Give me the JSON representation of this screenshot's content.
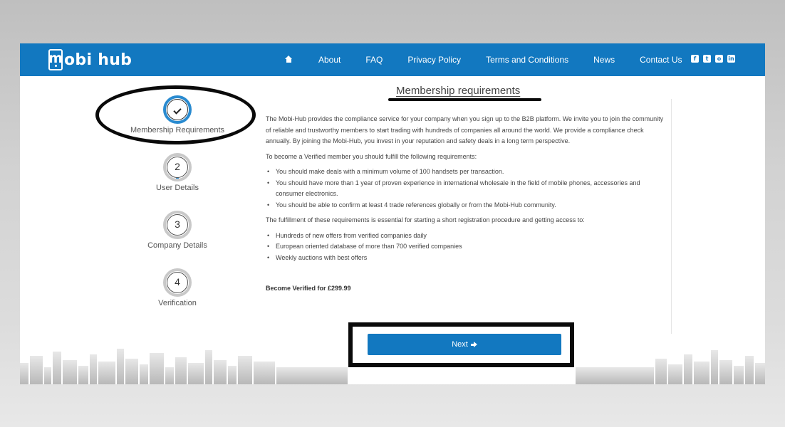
{
  "brand": {
    "logo_letter": "m",
    "logo_text": "obi hub"
  },
  "nav": {
    "items": [
      "About",
      "FAQ",
      "Privacy Policy",
      "Terms and Conditions",
      "News",
      "Contact Us"
    ],
    "social_icons": [
      "facebook-icon",
      "twitter-icon",
      "instagram-icon",
      "linkedin-icon"
    ]
  },
  "steps": [
    {
      "number": "",
      "label": "Membership Requirements",
      "state": "done"
    },
    {
      "number": "2",
      "label": "User Details"
    },
    {
      "number": "3",
      "label": "Company Details"
    },
    {
      "number": "4",
      "label": "Verification"
    }
  ],
  "content": {
    "title": "Membership requirements",
    "intro": "The Mobi-Hub provides the compliance service for your company when you sign up to the B2B platform. We invite you to join the community of reliable and trustworthy members to start trading with hundreds of companies all around the world. We provide a compliance check annually. By joining the Mobi-Hub, you invest in your reputation and safety deals in a long term perspective.",
    "requirements_intro": "To become a Verified member you should fulfill the following requirements:",
    "requirements": [
      "You should make deals with a minimum volume of 100 handsets per transaction.",
      "You should have more than 1 year of proven experience in international wholesale in the field of mobile phones, accessories and consumer electronics.",
      "You should be able to confirm at least 4 trade references globally or from the Mobi-Hub community."
    ],
    "benefits_intro": "The fulfillment of these requirements is essential for starting a short registration procedure and getting access to:",
    "benefits": [
      "Hundreds of new offers from verified companies daily",
      "European oriented database of more than 700 verified companies",
      "Weekly auctions with best offers"
    ],
    "price_text": "Become Verified for £299.99"
  },
  "next_button": {
    "label": "Next"
  },
  "colors": {
    "primary": "#1278c0",
    "step_active": "#2a8bd0",
    "annotation": "#0a0a0a"
  }
}
